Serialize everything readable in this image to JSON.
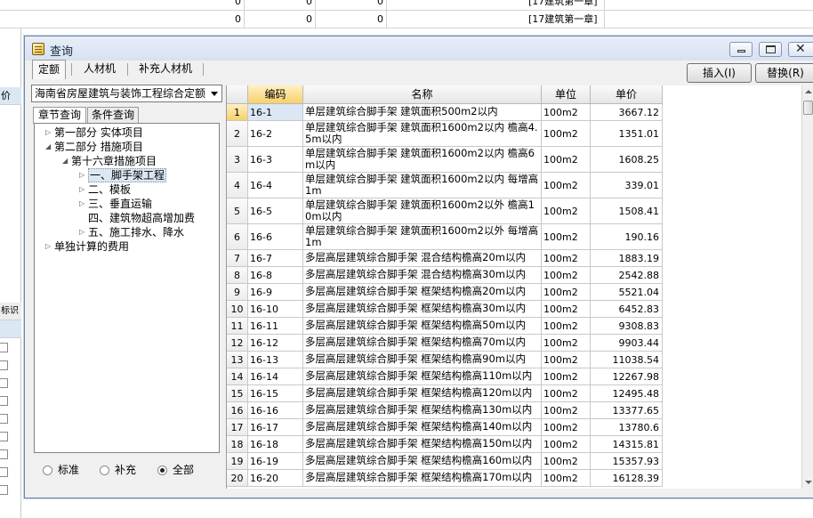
{
  "background": {
    "top_row": {
      "values": [
        "0",
        "0",
        "0"
      ],
      "chapter": "[17建筑第一章]"
    },
    "second_row": {
      "values": [
        "0",
        "0",
        "0"
      ],
      "chapter": "[17建筑第一章]"
    },
    "left_col_labels": {
      "price": "价",
      "mark": "标识"
    }
  },
  "dialog": {
    "title": "查询",
    "tabs": [
      "定额",
      "人材机",
      "补充人材机"
    ],
    "insert_label": "插入(I)",
    "replace_label": "替换(R)",
    "quota_library": "海南省房屋建筑与装饰工程综合定额",
    "subtabs": [
      "章节查询",
      "条件查询"
    ],
    "tree": [
      {
        "label": "第一部分 实体项目",
        "level": 0,
        "expanded": false
      },
      {
        "label": "第二部分 措施项目",
        "level": 0,
        "expanded": true
      },
      {
        "label": "第十六章措施项目",
        "level": 1,
        "expanded": true
      },
      {
        "label": "一、脚手架工程",
        "level": 2,
        "expanded": false,
        "selected": true
      },
      {
        "label": "二、模板",
        "level": 2,
        "expanded": false
      },
      {
        "label": "三、垂直运输",
        "level": 2,
        "expanded": false
      },
      {
        "label": "四、建筑物超高增加费",
        "level": 2,
        "leaf": true
      },
      {
        "label": "五、施工排水、降水",
        "level": 2,
        "expanded": false
      },
      {
        "label": "单独计算的费用",
        "level": 0,
        "expanded": false
      }
    ],
    "filter": {
      "options": [
        "标准",
        "补充",
        "全部"
      ],
      "selected": "全部"
    }
  },
  "grid": {
    "headers": [
      "编码",
      "名称",
      "单位",
      "单价"
    ],
    "rows": [
      {
        "n": "1",
        "code": "16-1",
        "name": "单层建筑综合脚手架 建筑面积500m2以内",
        "unit": "100m2",
        "price": "3667.12"
      },
      {
        "n": "2",
        "code": "16-2",
        "name": "单层建筑综合脚手架 建筑面积1600m2以内 檐高4.5m以内",
        "unit": "100m2",
        "price": "1351.01"
      },
      {
        "n": "3",
        "code": "16-3",
        "name": "单层建筑综合脚手架 建筑面积1600m2以内 檐高6m以内",
        "unit": "100m2",
        "price": "1608.25"
      },
      {
        "n": "4",
        "code": "16-4",
        "name": "单层建筑综合脚手架 建筑面积1600m2以内 每增高1m",
        "unit": "100m2",
        "price": "339.01"
      },
      {
        "n": "5",
        "code": "16-5",
        "name": "单层建筑综合脚手架 建筑面积1600m2以外 檐高10m以内",
        "unit": "100m2",
        "price": "1508.41"
      },
      {
        "n": "6",
        "code": "16-6",
        "name": "单层建筑综合脚手架 建筑面积1600m2以外 每增高1m",
        "unit": "100m2",
        "price": "190.16"
      },
      {
        "n": "7",
        "code": "16-7",
        "name": "多层高层建筑综合脚手架 混合结构檐高20m以内",
        "unit": "100m2",
        "price": "1883.19"
      },
      {
        "n": "8",
        "code": "16-8",
        "name": "多层高层建筑综合脚手架 混合结构檐高30m以内",
        "unit": "100m2",
        "price": "2542.88"
      },
      {
        "n": "9",
        "code": "16-9",
        "name": "多层高层建筑综合脚手架 框架结构檐高20m以内",
        "unit": "100m2",
        "price": "5521.04"
      },
      {
        "n": "10",
        "code": "16-10",
        "name": "多层高层建筑综合脚手架 框架结构檐高30m以内",
        "unit": "100m2",
        "price": "6452.83"
      },
      {
        "n": "11",
        "code": "16-11",
        "name": "多层高层建筑综合脚手架 框架结构檐高50m以内",
        "unit": "100m2",
        "price": "9308.83"
      },
      {
        "n": "12",
        "code": "16-12",
        "name": "多层高层建筑综合脚手架 框架结构檐高70m以内",
        "unit": "100m2",
        "price": "9903.44"
      },
      {
        "n": "13",
        "code": "16-13",
        "name": "多层高层建筑综合脚手架 框架结构檐高90m以内",
        "unit": "100m2",
        "price": "11038.54"
      },
      {
        "n": "14",
        "code": "16-14",
        "name": "多层高层建筑综合脚手架 框架结构檐高110m以内",
        "unit": "100m2",
        "price": "12267.98"
      },
      {
        "n": "15",
        "code": "16-15",
        "name": "多层高层建筑综合脚手架 框架结构檐高120m以内",
        "unit": "100m2",
        "price": "12495.48"
      },
      {
        "n": "16",
        "code": "16-16",
        "name": "多层高层建筑综合脚手架 框架结构檐高130m以内",
        "unit": "100m2",
        "price": "13377.65"
      },
      {
        "n": "17",
        "code": "16-17",
        "name": "多层高层建筑综合脚手架 框架结构檐高140m以内",
        "unit": "100m2",
        "price": "13780.6"
      },
      {
        "n": "18",
        "code": "16-18",
        "name": "多层高层建筑综合脚手架 框架结构檐高150m以内",
        "unit": "100m2",
        "price": "14315.81"
      },
      {
        "n": "19",
        "code": "16-19",
        "name": "多层高层建筑综合脚手架 框架结构檐高160m以内",
        "unit": "100m2",
        "price": "15357.93"
      },
      {
        "n": "20",
        "code": "16-20",
        "name": "多层高层建筑综合脚手架 框架结构檐高170m以内",
        "unit": "100m2",
        "price": "16128.39"
      }
    ]
  }
}
